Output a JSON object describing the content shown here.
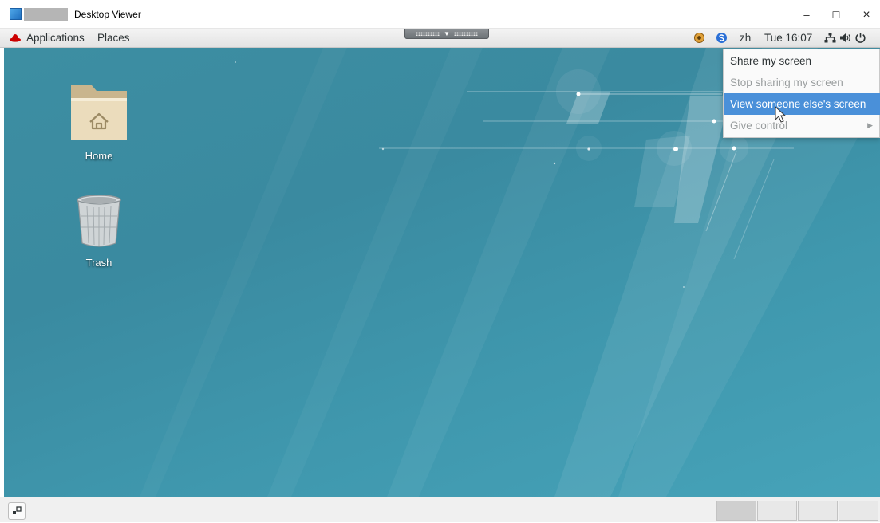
{
  "window": {
    "title": "Desktop Viewer",
    "controls": {
      "minimize": "–",
      "maximize": "☐",
      "close": "×"
    }
  },
  "topbar": {
    "applications": "Applications",
    "places": "Places",
    "language": "zh",
    "clock": "Tue 16:07"
  },
  "desktop": {
    "icons": [
      {
        "label": "Home",
        "icon": "home-folder-icon"
      },
      {
        "label": "Trash",
        "icon": "trash-icon"
      }
    ]
  },
  "menu": {
    "items": [
      {
        "label": "Share my screen",
        "state": "normal"
      },
      {
        "label": "Stop sharing my screen",
        "state": "disabled"
      },
      {
        "label": "View someone else's screen",
        "state": "highlighted"
      },
      {
        "label": "Give control",
        "state": "disabled",
        "submenu": true
      }
    ]
  },
  "colors": {
    "desktop": "#3d8ea2",
    "menu_highlight": "#4a90d9"
  }
}
